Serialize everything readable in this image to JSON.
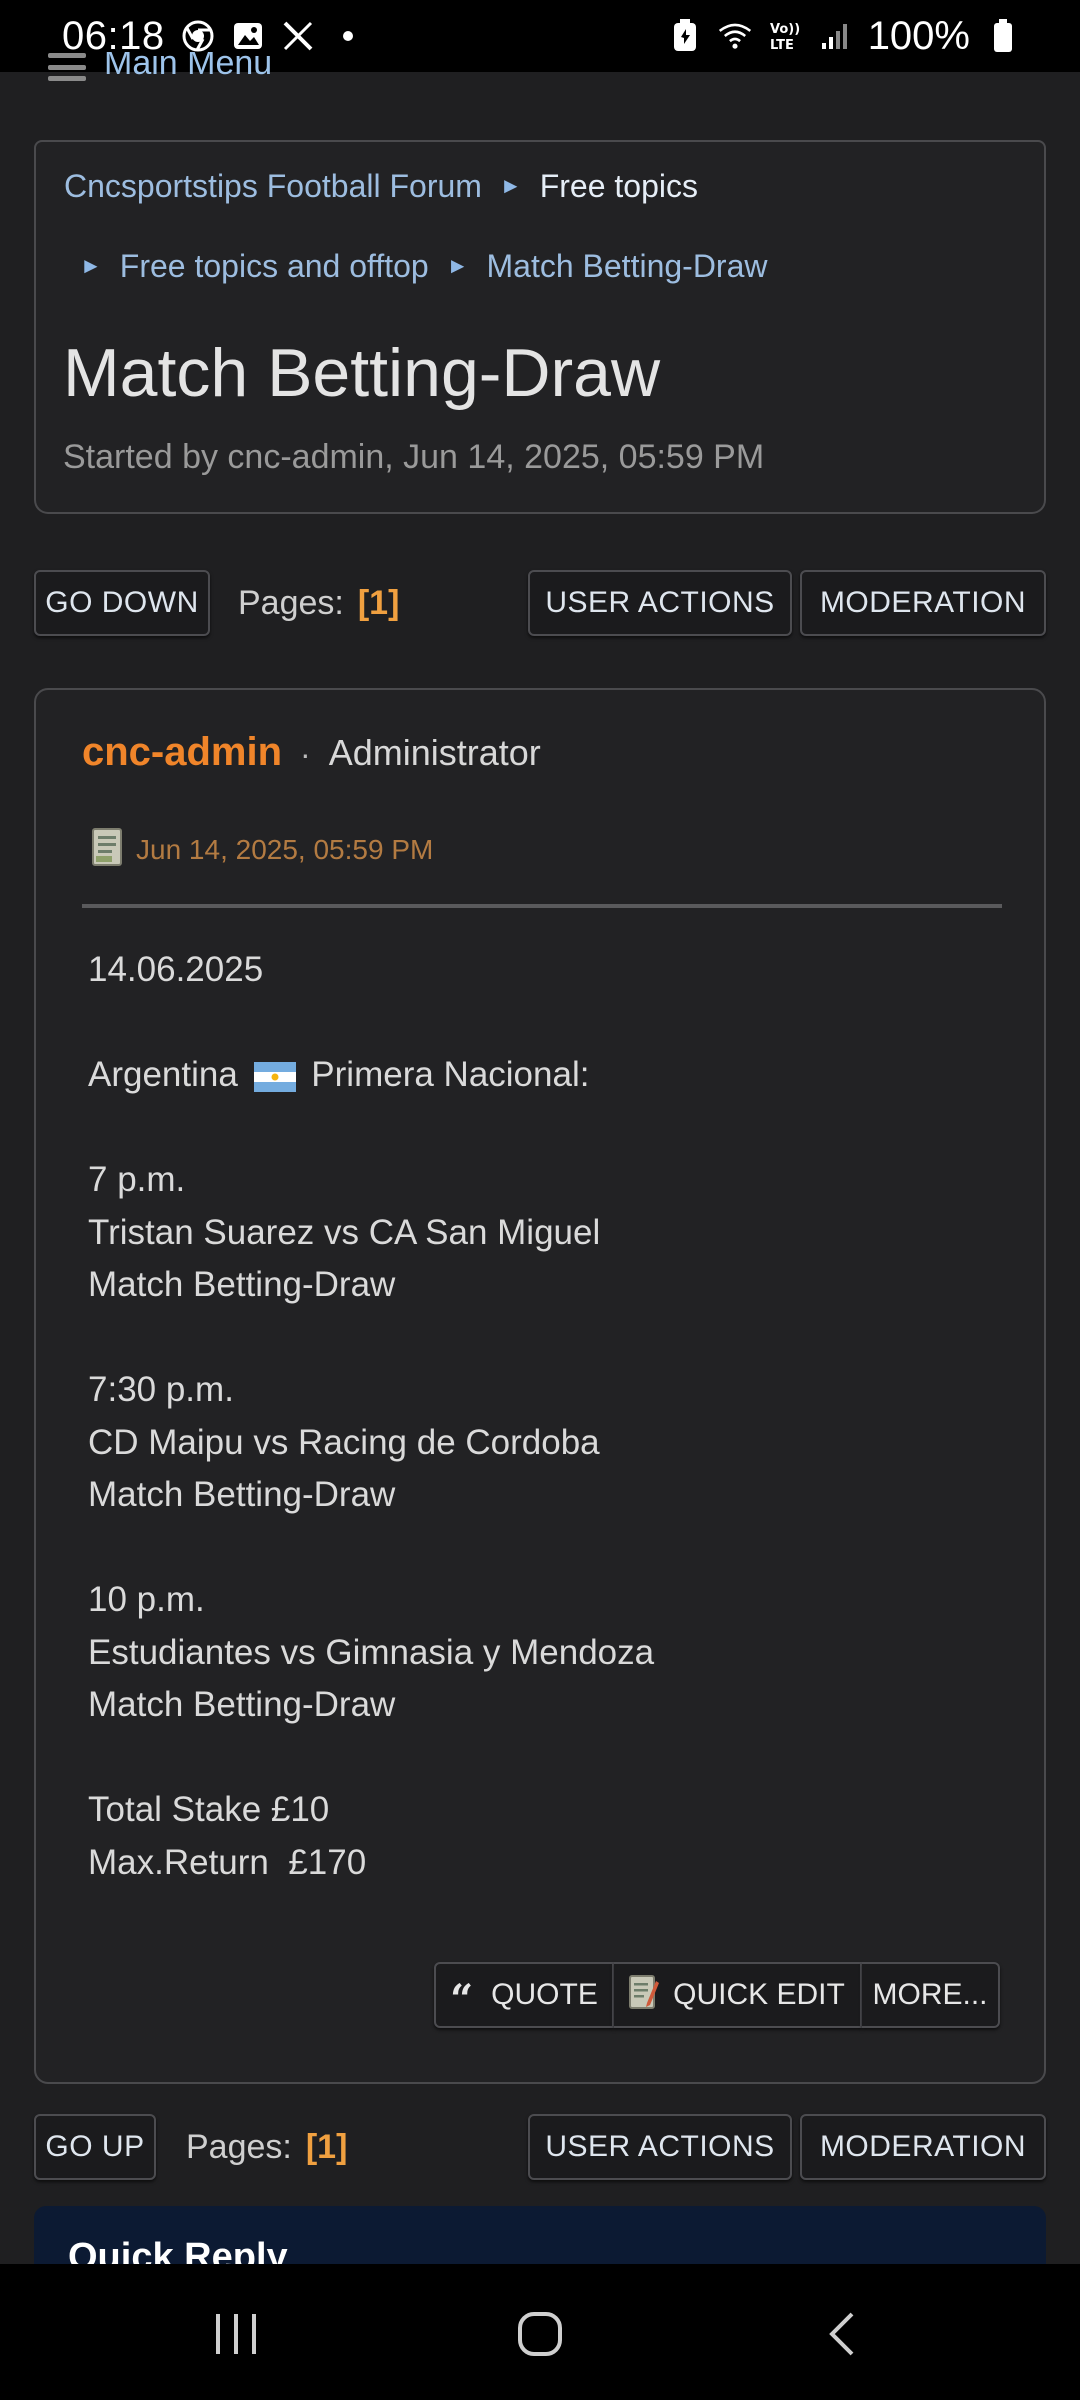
{
  "status_bar": {
    "time": "06:18",
    "battery": "100%",
    "icons": [
      "chrome-icon",
      "gallery-icon",
      "x-icon",
      "dot-icon",
      "battery-saver-icon",
      "wifi-icon",
      "volte-icon",
      "signal-icon",
      "battery-icon"
    ]
  },
  "main_menu": {
    "label": "Main Menu"
  },
  "breadcrumb": {
    "forum": "Cncsportstips Football Forum",
    "category": "Free topics",
    "board": "Free topics and offtop",
    "topic": "Match Betting-Draw"
  },
  "topic": {
    "title": "Match Betting-Draw",
    "started_by": "Started by cnc-admin, Jun 14, 2025, 05:59 PM"
  },
  "top_bar": {
    "go_down": "GO DOWN",
    "pages_label": "Pages:",
    "pages_value": "[1]",
    "user_actions": "USER ACTIONS",
    "moderation": "MODERATION"
  },
  "post": {
    "author": "cnc-admin",
    "separator": "·",
    "role": "Administrator",
    "date": "Jun 14, 2025, 05:59 PM",
    "body": {
      "date": "14.06.2025",
      "league_prefix": "Argentina",
      "league_suffix": "Primera Nacional:",
      "m1_time": "7 p.m.",
      "m1_teams": "Tristan Suarez vs CA San Miguel",
      "m1_bet": "Match Betting-Draw",
      "m2_time": "7:30 p.m.",
      "m2_teams": "CD Maipu vs Racing de Cordoba",
      "m2_bet": "Match Betting-Draw",
      "m3_time": "10 p.m.",
      "m3_teams": "Estudiantes vs Gimnasia y Mendoza",
      "m3_bet": "Match Betting-Draw",
      "stake": "Total Stake £10",
      "max_return": "Max.Return  £170"
    },
    "actions": {
      "quote": "QUOTE",
      "quick_edit": "QUICK EDIT",
      "more": "MORE..."
    }
  },
  "bottom_bar": {
    "go_up": "GO UP",
    "pages_label": "Pages:",
    "pages_value": "[1]",
    "user_actions": "USER ACTIONS",
    "moderation": "MODERATION"
  },
  "quick_reply": {
    "title": "Quick Reply"
  },
  "colors": {
    "background": "#1f1f21",
    "link": "#9dbde0",
    "author": "#f0852a",
    "page_number": "#f0a040",
    "post_date": "#b37b42",
    "quick_reply_bg": "#0c1a33"
  }
}
